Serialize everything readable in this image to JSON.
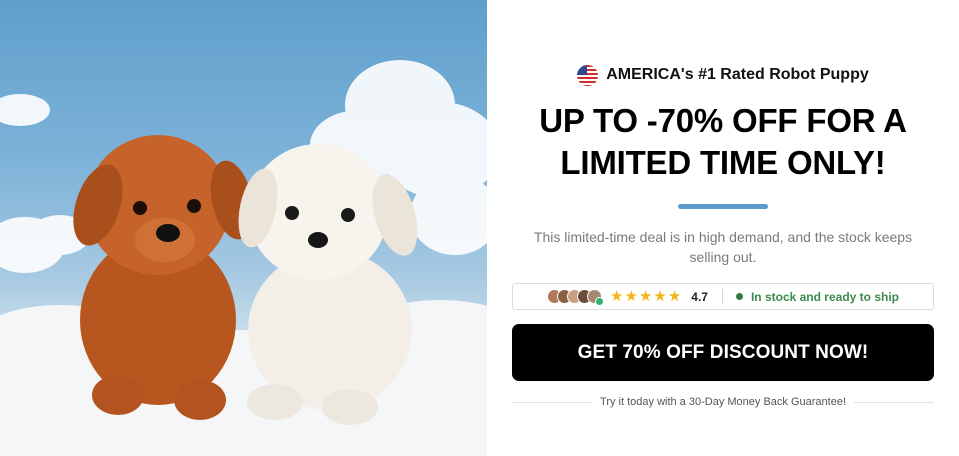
{
  "image": {
    "alt_subject": "two puppies"
  },
  "offer": {
    "eyebrow": "AMERICA's #1 Rated Robot Puppy",
    "flag_icon": "us-flag-icon",
    "headline": "UP TO -70% OFF FOR A LIMITED TIME ONLY!",
    "subtext": "This limited-time deal is in high demand, and the stock keeps selling out.",
    "accent_color": "#5a9bcb"
  },
  "trust": {
    "avatar_colors": [
      "#b07a5a",
      "#8b5e45",
      "#c9a07f",
      "#6d4a3a",
      "#a7886f"
    ],
    "star_icon": "star-icon",
    "star_count": 5,
    "rating": "4.7",
    "stock_text": "In stock and ready to ship",
    "stock_color": "#3c8a4e"
  },
  "cta": {
    "label": "GET 70% OFF DISCOUNT NOW!"
  },
  "guarantee": {
    "text": "Try it today with a 30-Day Money Back Guarantee!"
  }
}
